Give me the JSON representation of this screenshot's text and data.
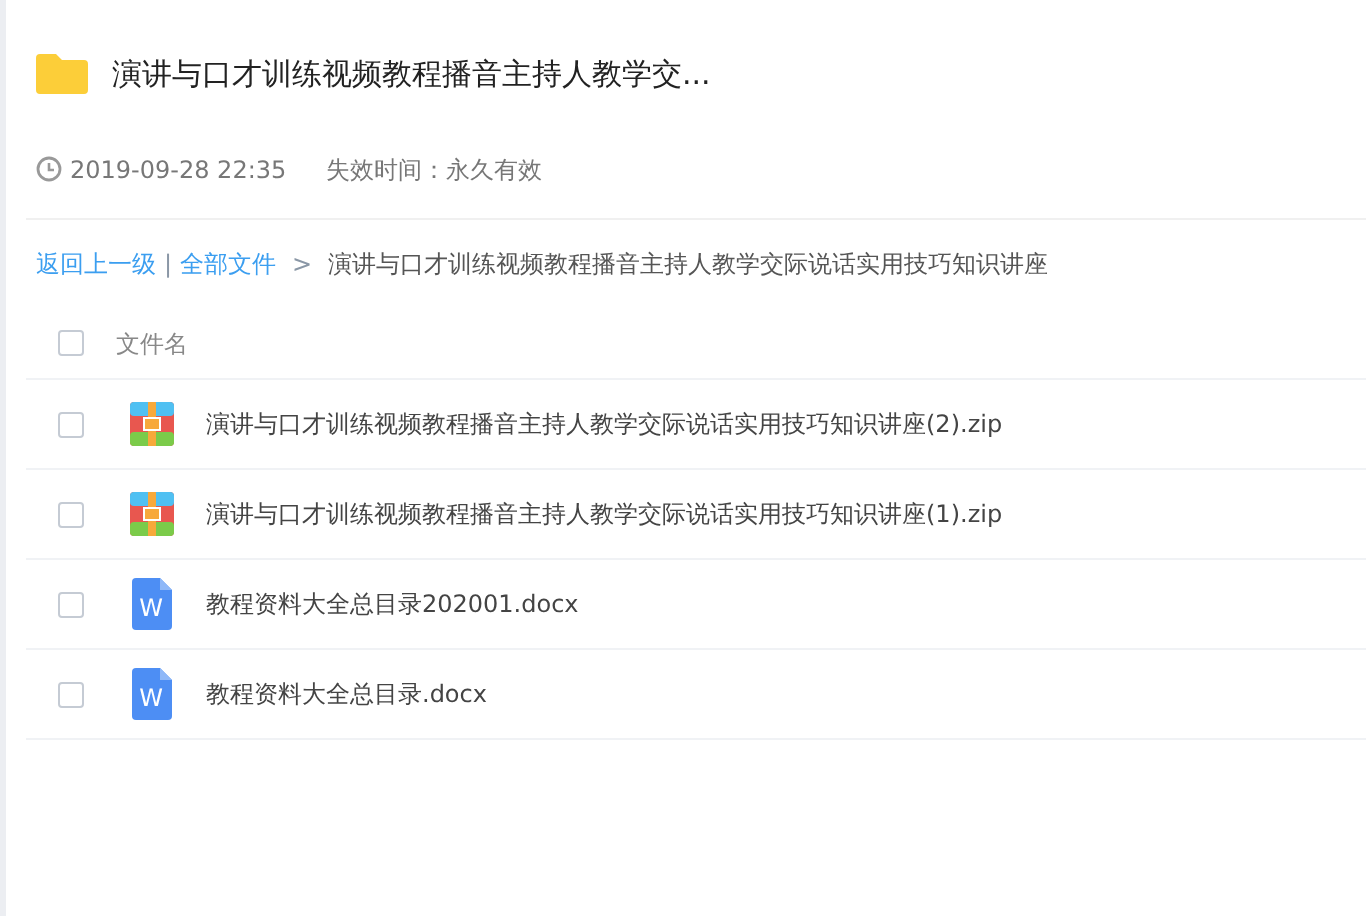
{
  "share": {
    "title": "演讲与口才训练视频教程播音主持人教学交...",
    "date": "2019-09-28 22:35",
    "expiry": "失效时间：永久有效"
  },
  "breadcrumb": {
    "links": [
      "返回上一级",
      "全部文件"
    ],
    "separator": "|",
    "arrow": ">",
    "current": "演讲与口才训练视频教程播音主持人教学交际说话实用技巧知识讲座"
  },
  "header": {
    "label": "文件名",
    "checked": false
  },
  "files": [
    {
      "name": "演讲与口才训练视频教程播音主持人教学交际说话实用技巧知识讲座(2).zip",
      "kind": "zip",
      "checked": false
    },
    {
      "name": "演讲与口才训练视频教程播音主持人教学交际说话实用技巧知识讲座(1).zip",
      "kind": "zip",
      "checked": false
    },
    {
      "name": "教程资料大全总目录202001.docx",
      "kind": "doc",
      "icon_text": "W",
      "checked": false
    },
    {
      "name": "教程资料大全总目录.docx",
      "kind": "doc",
      "icon_text": "W",
      "checked": false
    }
  ]
}
